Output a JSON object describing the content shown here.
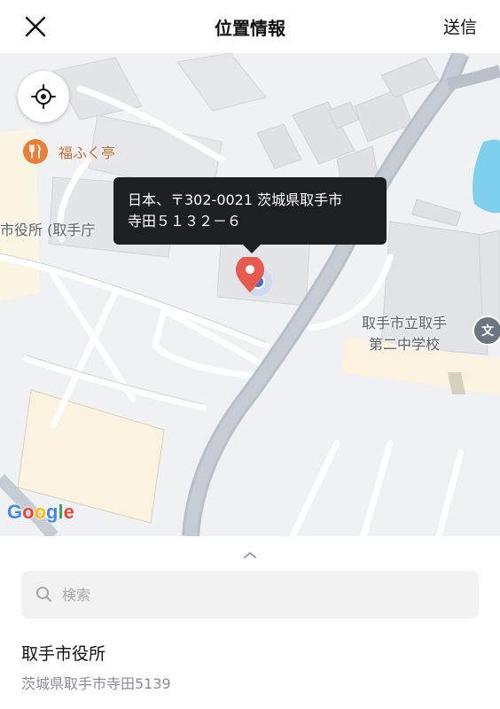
{
  "header": {
    "title": "位置情報",
    "send_label": "送信"
  },
  "map": {
    "callout": {
      "line1": "日本、〒302-0021 茨城県取手市",
      "line2": "寺田５１３２－６"
    },
    "pois": {
      "restaurant": "福ふく亭",
      "city_hall": "市役所 (取手庁",
      "school_line1": "取手市立取手",
      "school_line2": "第二中学校",
      "school_icon_glyph": "文"
    },
    "attribution": [
      "G",
      "o",
      "o",
      "g",
      "l",
      "e"
    ],
    "colors": {
      "pin": "#e65a4f",
      "callout_bg": "#1e1f21",
      "road_main": "#b9c0c9",
      "water": "#7fd0ec"
    }
  },
  "search": {
    "placeholder": "検索",
    "value": ""
  },
  "results": [
    {
      "name": "取手市役所",
      "address": "茨城県取手市寺田5139"
    }
  ]
}
